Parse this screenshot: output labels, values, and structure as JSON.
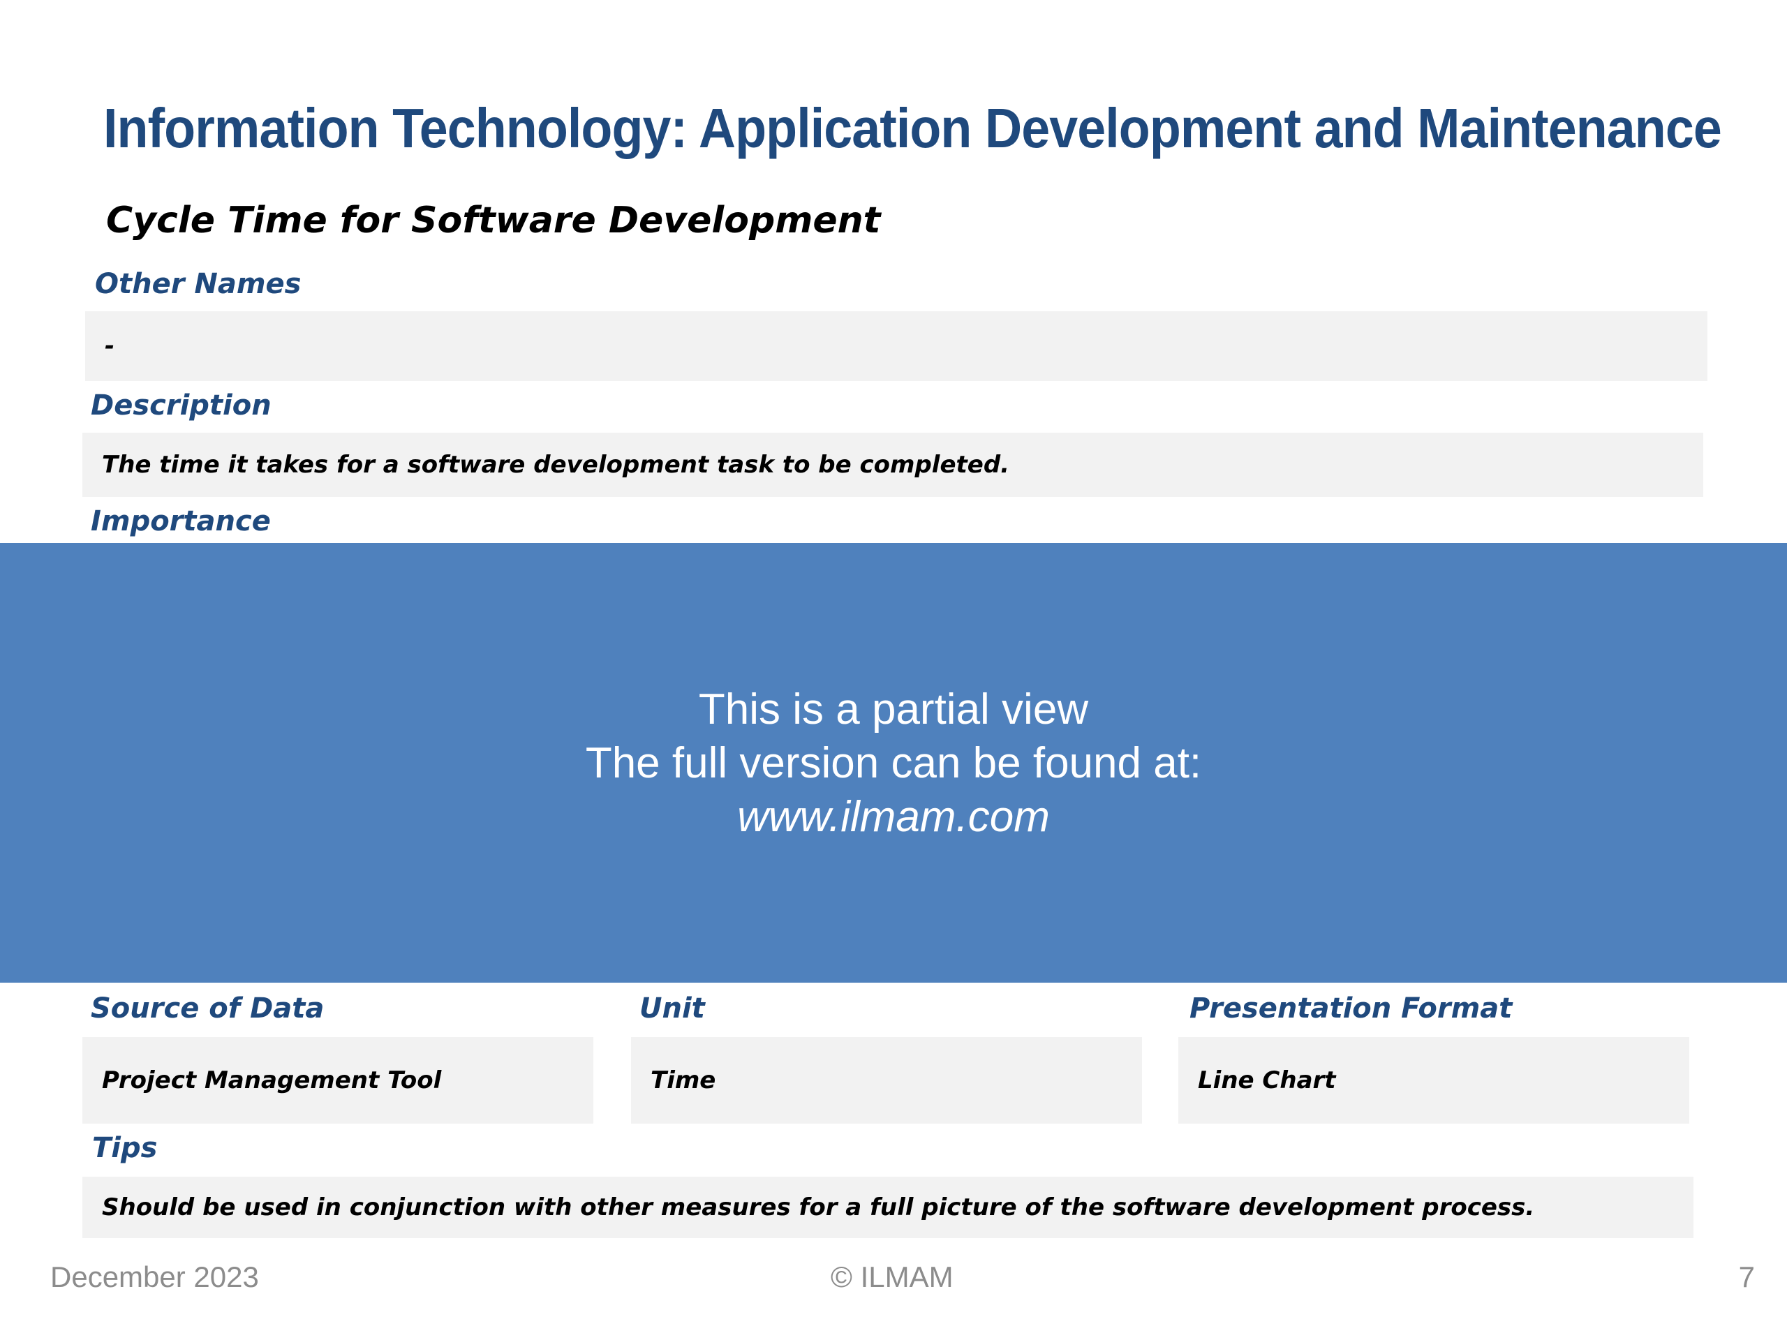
{
  "title": "Information Technology: Application Development and Maintenance",
  "subtitle": "Cycle Time for Software Development",
  "sections": {
    "other_names": {
      "label": "Other Names",
      "value": "-"
    },
    "description": {
      "label": "Description",
      "value": "The time it takes for a software development task to be completed."
    },
    "importance": {
      "label": "Importance"
    },
    "source_of_data": {
      "label": "Source of Data",
      "value": "Project Management Tool"
    },
    "unit": {
      "label": "Unit",
      "value": "Time"
    },
    "presentation_format": {
      "label": "Presentation Format",
      "value": "Line Chart"
    },
    "tips": {
      "label": "Tips",
      "value": "Should be used in conjunction with other measures for a full picture of the software development process."
    }
  },
  "overlay": {
    "line1": "This is a partial view",
    "line2": "The full version can be found at:",
    "url": "www.ilmam.com"
  },
  "footer": {
    "date": "December 2023",
    "copyright": "© ILMAM",
    "page_number": "7"
  },
  "colors": {
    "heading": "#1f497d",
    "overlay": "#4f81bd",
    "box": "#f2f2f2",
    "footer": "#8c8c8c"
  }
}
